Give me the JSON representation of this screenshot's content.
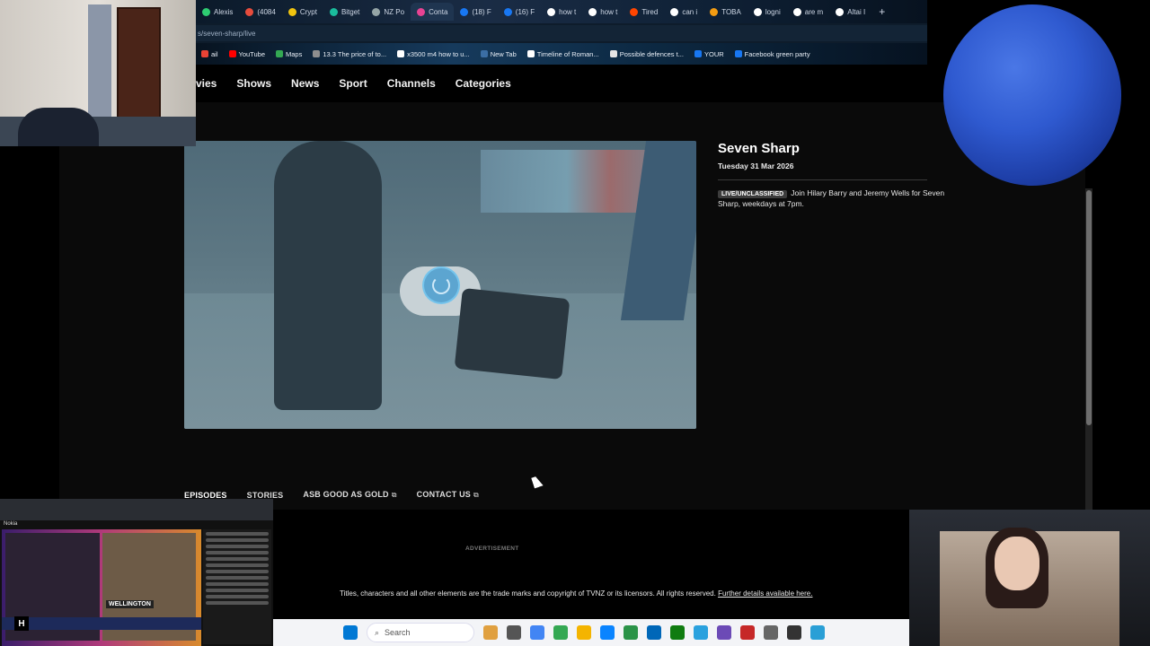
{
  "browser": {
    "tabs": [
      {
        "label": "Alexis",
        "color": "#2ecc71"
      },
      {
        "label": "(4084",
        "color": "#e74c3c"
      },
      {
        "label": "Crypt",
        "color": "#f1c40f"
      },
      {
        "label": "Bitget",
        "color": "#1abc9c"
      },
      {
        "label": "NZ Po",
        "color": "#95a5a6"
      },
      {
        "label": "Conta",
        "color": "#e84393",
        "active": true
      },
      {
        "label": "(18) F",
        "color": "#1877f2"
      },
      {
        "label": "(16) F",
        "color": "#1877f2"
      },
      {
        "label": "how t",
        "color": "#ffffff"
      },
      {
        "label": "how t",
        "color": "#ffffff"
      },
      {
        "label": "Tired",
        "color": "#ff4500"
      },
      {
        "label": "can i",
        "color": "#ffffff"
      },
      {
        "label": "TOBA",
        "color": "#f39c12"
      },
      {
        "label": "logni",
        "color": "#ffffff"
      },
      {
        "label": "are m",
        "color": "#ffffff"
      },
      {
        "label": "Altai I",
        "color": "#ffffff"
      }
    ],
    "new_tab": "+",
    "url": "s/seven-sharp/live",
    "bookmarks": [
      {
        "label": "ail",
        "color": "#ea4335"
      },
      {
        "label": "YouTube",
        "color": "#ff0000"
      },
      {
        "label": "Maps",
        "color": "#34a853"
      },
      {
        "label": "13.3 The price of to...",
        "color": "#8e8e8e"
      },
      {
        "label": "x3500 m4 how to u...",
        "color": "#ffffff"
      },
      {
        "label": "New Tab",
        "color": "#3b6ea5"
      },
      {
        "label": "Timeline of Roman...",
        "color": "#ffffff"
      },
      {
        "label": "Possible defences t...",
        "color": "#e5e5e5"
      },
      {
        "label": "YOUR",
        "color": "#1877f2"
      },
      {
        "label": "Facebook green party",
        "color": "#1877f2"
      }
    ]
  },
  "site_nav": [
    "vies",
    "Shows",
    "News",
    "Sport",
    "Channels",
    "Categories"
  ],
  "show": {
    "title": "Seven Sharp",
    "date": "Tuesday 31 Mar 2026",
    "badge": "LIVE/UNCLASSIFIED",
    "description": "Join Hilary Barry and Jeremy Wells for Seven Sharp, weekdays at 7pm."
  },
  "sub_tabs": [
    {
      "label": "EPISODES",
      "active": true,
      "external": false
    },
    {
      "label": "STORIES",
      "active": false,
      "external": false
    },
    {
      "label": "ASB GOOD AS GOLD",
      "active": false,
      "external": true
    },
    {
      "label": "CONTACT US",
      "active": false,
      "external": true
    }
  ],
  "external_glyph": "⧉",
  "footer": {
    "advertisement": "ADVERTISEMENT",
    "copyright": "Titles, characters and all other elements are the trade marks and copyright of TVNZ or its licensors. All rights reserved.",
    "further_link": "Further details available here."
  },
  "taskbar": {
    "search_placeholder": "Search",
    "icons": [
      "windows-start-icon",
      "widgets-icon",
      "task-view-icon",
      "chrome-icon",
      "chrome-beta-icon",
      "file-explorer-icon",
      "edge-icon",
      "edge-dev-icon",
      "store-icon",
      "game-icon",
      "telegram-icon",
      "obs-icon",
      "pdf-icon",
      "settings-icon",
      "vpn-icon",
      "photos-icon"
    ]
  },
  "overlay": {
    "news_label": "WELLINGTON",
    "news_logo": "H",
    "news_brand": "Nokia"
  }
}
